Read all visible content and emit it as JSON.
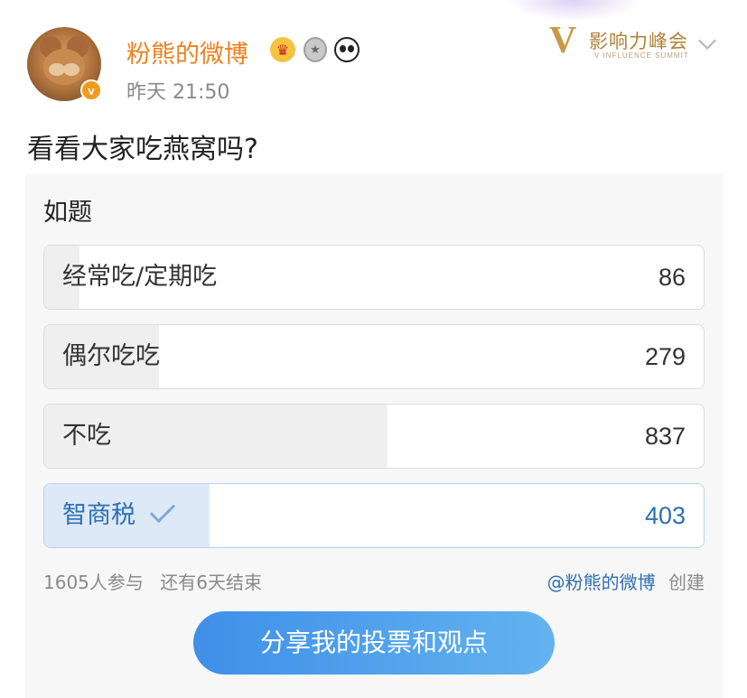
{
  "post": {
    "username": "粉熊的微博",
    "verified_badge": "v",
    "timestamp": "昨天 21:50",
    "text": "看看大家吃燕窝吗?",
    "badges": [
      "crown-icon",
      "medal-icon",
      "panda-icon"
    ]
  },
  "brand": {
    "mark": "V",
    "name": "影响力峰会",
    "subtitle": "V INFLUENCE SUMMIT",
    "color": "#c79a4a"
  },
  "poll": {
    "title": "如题",
    "options": [
      {
        "label": "经常吃/定期吃",
        "count": "86",
        "share": 0.054,
        "selected": false
      },
      {
        "label": "偶尔吃吃",
        "count": "279",
        "share": 0.174,
        "selected": false
      },
      {
        "label": "不吃",
        "count": "837",
        "share": 0.521,
        "selected": false
      },
      {
        "label": "智商税",
        "count": "403",
        "share": 0.251,
        "selected": true
      }
    ],
    "participants": "1605人参与",
    "remaining": "还有6天结束",
    "creator": "@粉熊的微博",
    "created_label": "创建",
    "share_button": "分享我的投票和观点"
  },
  "colors": {
    "username": "#f07f1d",
    "selected": "#2f6fb3",
    "button_start": "#3f8fe8",
    "button_end": "#63b3f0"
  }
}
